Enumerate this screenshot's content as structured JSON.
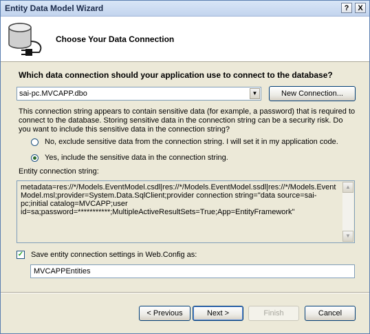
{
  "window": {
    "title": "Entity Data Model Wizard",
    "help_button": "?",
    "close_button": "X"
  },
  "header": {
    "title": "Choose Your Data Connection"
  },
  "connection": {
    "question": "Which data connection should your application use to connect to the database?",
    "selected": "sai-pc.MVCAPP.dbo",
    "new_connection_label": "New Connection..."
  },
  "sensitive": {
    "message": "This connection string appears to contain sensitive data (for example, a password) that is required to connect to the database. Storing sensitive data in the connection string can be a security risk. Do you want to include this sensitive data in the connection string?",
    "option_no": "No, exclude sensitive data from the connection string. I will set it in my application code.",
    "option_yes": "Yes, include the sensitive data in the connection string.",
    "selected_option": "yes"
  },
  "entity_string": {
    "label": "Entity connection string:",
    "value": "metadata=res://*/Models.EventModel.csdl|res://*/Models.EventModel.ssdl|res://*/Models.EventModel.msl;provider=System.Data.SqlClient;provider connection string=\"data source=sai-pc;initial catalog=MVCAPP;user id=sa;password=***********;MultipleActiveResultSets=True;App=EntityFramework\""
  },
  "save_settings": {
    "checked": true,
    "label": "Save entity connection settings in Web.Config as:",
    "value": "MVCAPPEntities"
  },
  "footer": {
    "previous_label": "< Previous",
    "next_label": "Next >",
    "finish_label": "Finish",
    "cancel_label": "Cancel"
  },
  "icons": {
    "database": "database-plug-icon",
    "combo_arrow": "chevron-down-icon",
    "scroll_up": "scroll-up-arrow-icon",
    "scroll_down": "scroll-down-arrow-icon",
    "check": "checkmark-icon"
  }
}
